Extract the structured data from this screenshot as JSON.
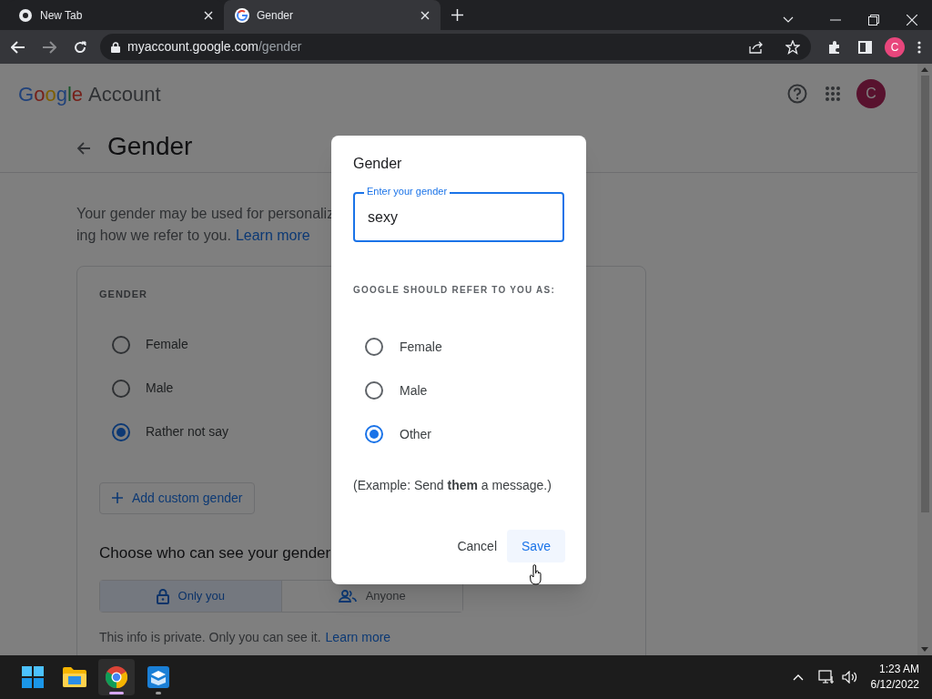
{
  "browser": {
    "tabs": [
      {
        "title": "New Tab",
        "selected": false
      },
      {
        "title": "Gender",
        "selected": true
      }
    ],
    "url": {
      "host": "myaccount.google.com",
      "path": "/gender"
    },
    "profile_initial": "C"
  },
  "page": {
    "logo": {
      "brand": "Google",
      "product": "Account"
    },
    "avatar_initial": "C",
    "title": "Gender",
    "intro": [
      "Your gender may be used for personaliz",
      "ing how we refer to you."
    ],
    "intro_link": "Learn more",
    "card": {
      "heading": "GENDER",
      "options": [
        {
          "label": "Female",
          "selected": false
        },
        {
          "label": "Male",
          "selected": false
        },
        {
          "label": "Rather not say",
          "selected": true
        }
      ],
      "add_button": "Add custom gender",
      "visibility_heading": "Choose who can see your gender",
      "visibility": [
        {
          "label": "Only you",
          "kind": "lock",
          "selected": true
        },
        {
          "label": "Anyone",
          "kind": "people",
          "selected": false
        }
      ],
      "info": "This info is private. Only you can see it.",
      "info_link": "Learn more"
    }
  },
  "dialog": {
    "title": "Gender",
    "field": {
      "label": "Enter your gender",
      "value": "sexy"
    },
    "refer_heading": "GOOGLE SHOULD REFER TO YOU AS:",
    "options": [
      {
        "label": "Female",
        "selected": false
      },
      {
        "label": "Male",
        "selected": false
      },
      {
        "label": "Other",
        "selected": true
      }
    ],
    "example": "(Example: Send **them** a message.)",
    "cancel": "Cancel",
    "save": "Save"
  },
  "taskbar": {
    "apps": [
      {
        "kind": "start",
        "running": false,
        "selected": false
      },
      {
        "kind": "folder",
        "running": false,
        "selected": false
      },
      {
        "kind": "browser",
        "running": true,
        "selected": true
      },
      {
        "kind": "box",
        "running": true,
        "selected": false
      }
    ],
    "time": "1:23 AM",
    "date": "6/12/2022"
  }
}
